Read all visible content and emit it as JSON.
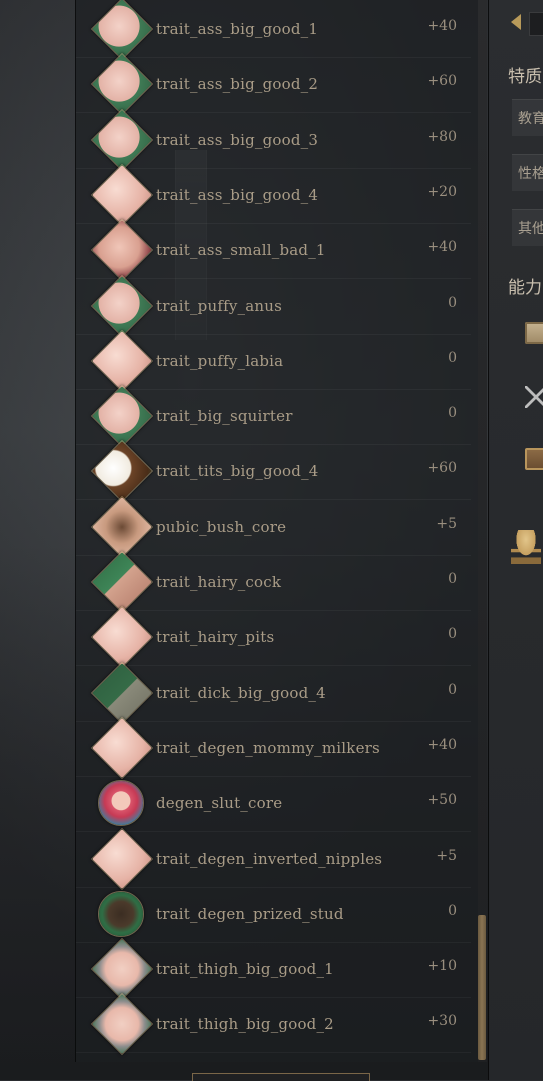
{
  "traits": [
    {
      "name": "trait_ass_big_good_1",
      "value": "+40",
      "icon": "buttocks-icon",
      "style": "icon-skin-green"
    },
    {
      "name": "trait_ass_big_good_2",
      "value": "+60",
      "icon": "buttocks-icon",
      "style": "icon-skin-green"
    },
    {
      "name": "trait_ass_big_good_3",
      "value": "+80",
      "icon": "buttocks-icon",
      "style": "icon-skin-green"
    },
    {
      "name": "trait_ass_big_good_4",
      "value": "+20",
      "icon": "buttocks-icon",
      "style": "icon-skin"
    },
    {
      "name": "trait_ass_small_bad_1",
      "value": "+40",
      "icon": "buttocks-icon",
      "style": "icon-dark-red"
    },
    {
      "name": "trait_puffy_anus",
      "value": "0",
      "icon": "anatomy-icon",
      "style": "icon-skin-green"
    },
    {
      "name": "trait_puffy_labia",
      "value": "0",
      "icon": "anatomy-icon",
      "style": "icon-skin"
    },
    {
      "name": "trait_big_squirter",
      "value": "0",
      "icon": "anatomy-icon",
      "style": "icon-skin-green"
    },
    {
      "name": "trait_tits_big_good_4",
      "value": "+60",
      "icon": "coconut-icon",
      "style": "icon-coconut"
    },
    {
      "name": "pubic_bush_core",
      "value": "+5",
      "icon": "pubic-hair-icon",
      "style": "icon-hairy"
    },
    {
      "name": "trait_hairy_cock",
      "value": "0",
      "icon": "arm-icon",
      "style": "icon-green-arm"
    },
    {
      "name": "trait_hairy_pits",
      "value": "0",
      "icon": "torso-icon",
      "style": "icon-skin"
    },
    {
      "name": "trait_dick_big_good_4",
      "value": "0",
      "icon": "anatomy-icon",
      "style": "icon-dick"
    },
    {
      "name": "trait_degen_mommy_milkers",
      "value": "+40",
      "icon": "breasts-icon",
      "style": "icon-skin"
    },
    {
      "name": "degen_slut_core",
      "value": "+50",
      "icon": "portrait-icon",
      "style": "icon-portrait",
      "circle": true
    },
    {
      "name": "trait_degen_inverted_nipples",
      "value": "+5",
      "icon": "breasts-icon",
      "style": "icon-skin"
    },
    {
      "name": "trait_degen_prized_stud",
      "value": "0",
      "icon": "bull-icon",
      "style": "icon-bull",
      "circle": true
    },
    {
      "name": "trait_thigh_big_good_1",
      "value": "+10",
      "icon": "thigh-icon",
      "style": "icon-thigh"
    },
    {
      "name": "trait_thigh_big_good_2",
      "value": "+30",
      "icon": "thigh-icon",
      "style": "icon-thigh"
    }
  ],
  "right_panel": {
    "traits_heading": "特质",
    "education_label": "教育",
    "personality_label": "性格",
    "other_label": "其他",
    "abilities_heading": "能力"
  }
}
